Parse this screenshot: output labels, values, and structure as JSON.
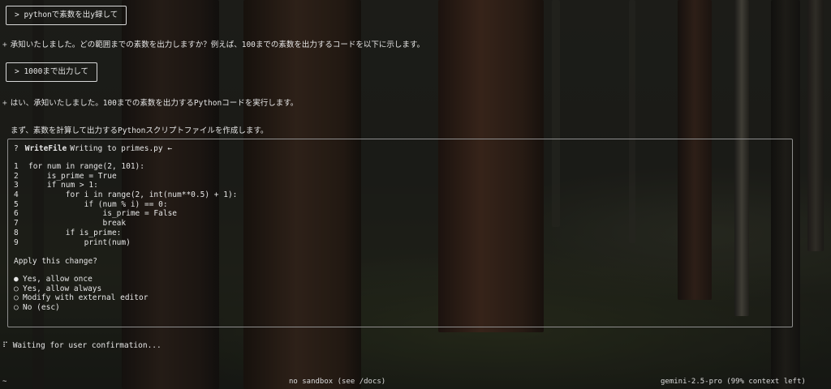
{
  "conversation": {
    "prompt1": "> pythonで素数を出y録して",
    "response1": "承知いたしました。どの範囲までの素数を出力しますか？例えば、100までの素数を出力するコードを以下に示します。",
    "prompt2": "> 1000まで出力して",
    "response2": "はい、承知いたしました。100までの素数を出力するPythonコードを実行します。",
    "response3": "まず、素数を計算して出力するPythonスクリプトファイルを作成します。",
    "bullet": "+"
  },
  "tool_call": {
    "status_icon": "?",
    "tool_name": "WriteFile",
    "description": "Writing to primes.py ←",
    "code_lines": [
      {
        "num": "1",
        "text": "for num in range(2, 101):"
      },
      {
        "num": "2",
        "text": "    is_prime = True"
      },
      {
        "num": "3",
        "text": "    if num > 1:"
      },
      {
        "num": "4",
        "text": "        for i in range(2, int(num**0.5) + 1):"
      },
      {
        "num": "5",
        "text": "            if (num % i) == 0:"
      },
      {
        "num": "6",
        "text": "                is_prime = False"
      },
      {
        "num": "7",
        "text": "                break"
      },
      {
        "num": "8",
        "text": "        if is_prime:"
      },
      {
        "num": "9",
        "text": "            print(num)"
      }
    ],
    "question": "Apply this change?",
    "options": [
      {
        "radio": "●",
        "label": "Yes, allow once"
      },
      {
        "radio": "○",
        "label": "Yes, allow always"
      },
      {
        "radio": "○",
        "label": "Modify with external editor"
      },
      {
        "radio": "○",
        "label": "No (esc)"
      }
    ]
  },
  "waiting": {
    "icon": "⠏",
    "text": "Waiting for user confirmation..."
  },
  "statusbar": {
    "cwd": "~",
    "sandbox": "no sandbox (see /docs)",
    "model": "gemini-2.5-pro (99% context left)"
  }
}
